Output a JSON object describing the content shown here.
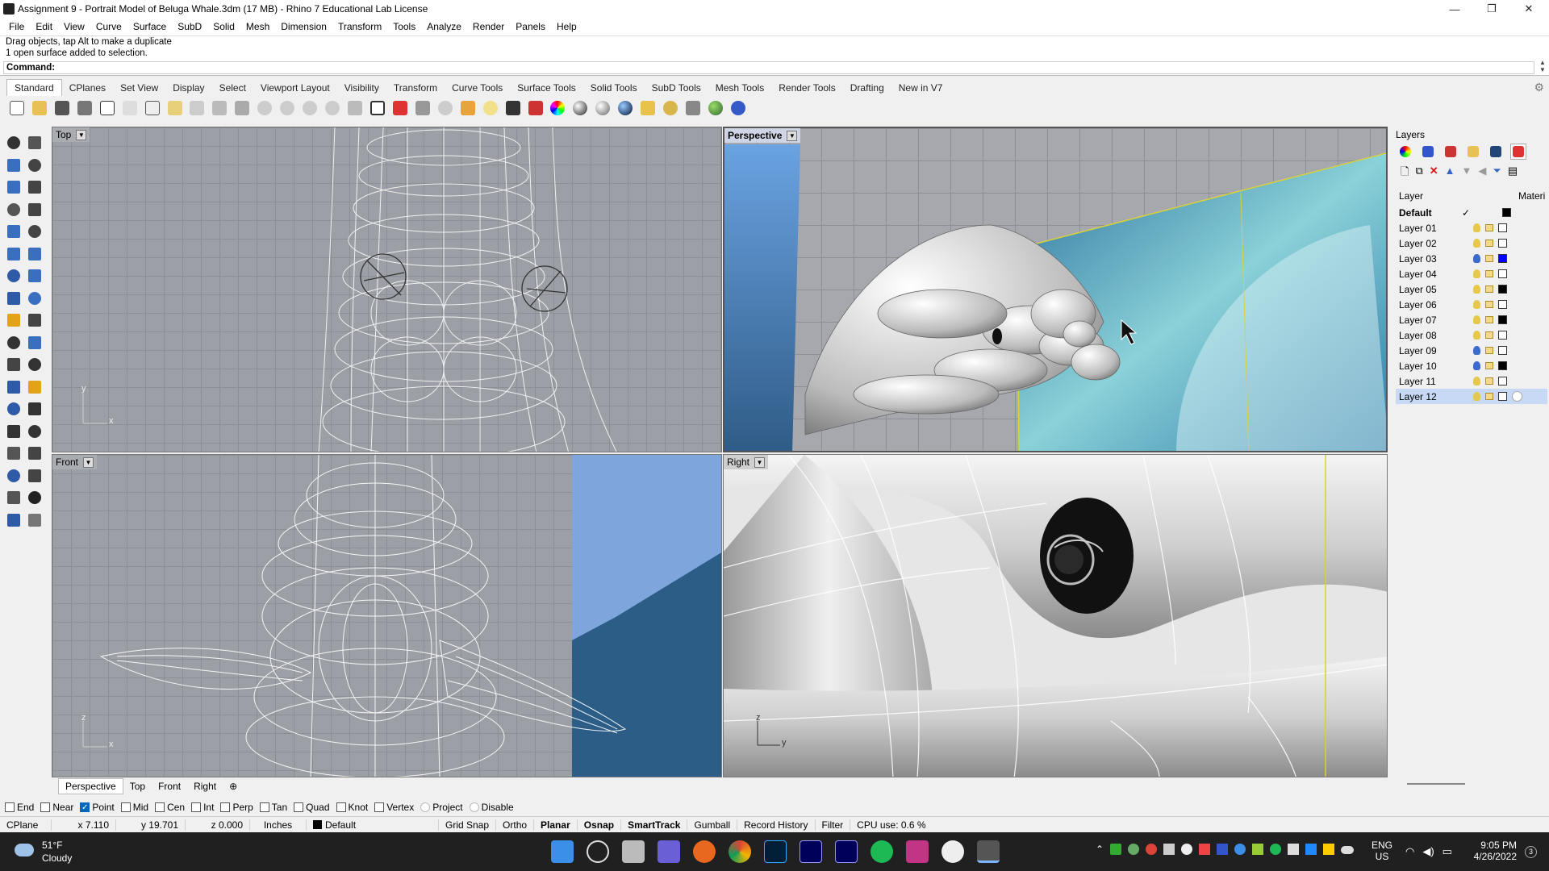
{
  "window": {
    "title": "Assignment 9 - Portrait Model of Beluga Whale.3dm (17 MB) - Rhino 7 Educational Lab License",
    "min": "—",
    "max": "❐",
    "close": "✕"
  },
  "menu": [
    "File",
    "Edit",
    "View",
    "Curve",
    "Surface",
    "SubD",
    "Solid",
    "Mesh",
    "Dimension",
    "Transform",
    "Tools",
    "Analyze",
    "Render",
    "Panels",
    "Help"
  ],
  "command": {
    "history1": "Drag objects, tap Alt to make a duplicate",
    "history2": "1 open surface added to selection.",
    "prompt": "Command:"
  },
  "toolbar_tabs": [
    "Standard",
    "CPlanes",
    "Set View",
    "Display",
    "Select",
    "Viewport Layout",
    "Visibility",
    "Transform",
    "Curve Tools",
    "Surface Tools",
    "Solid Tools",
    "SubD Tools",
    "Mesh Tools",
    "Render Tools",
    "Drafting",
    "New in V7"
  ],
  "viewports": {
    "top": "Top",
    "perspective": "Perspective",
    "front": "Front",
    "right": "Right"
  },
  "axes": {
    "top_y": "y",
    "top_x": "x",
    "front_z": "z",
    "front_x": "x",
    "right_z": "z",
    "right_y": "y"
  },
  "view_tabs": [
    "Perspective",
    "Top",
    "Front",
    "Right"
  ],
  "layers": {
    "title": "Layers",
    "col_layer": "Layer",
    "col_material": "Materi",
    "rows": [
      {
        "name": "Default",
        "color": "#000000"
      },
      {
        "name": "Layer 01",
        "color": "#ffffff"
      },
      {
        "name": "Layer 02",
        "color": "#ffffff"
      },
      {
        "name": "Layer 03",
        "color": "#0000ff"
      },
      {
        "name": "Layer 04",
        "color": "#ffffff"
      },
      {
        "name": "Layer 05",
        "color": "#000000"
      },
      {
        "name": "Layer 06",
        "color": "#ffffff"
      },
      {
        "name": "Layer 07",
        "color": "#000000"
      },
      {
        "name": "Layer 08",
        "color": "#ffffff"
      },
      {
        "name": "Layer 09",
        "color": "#ffffff"
      },
      {
        "name": "Layer 10",
        "color": "#000000"
      },
      {
        "name": "Layer 11",
        "color": "#ffffff"
      },
      {
        "name": "Layer 12",
        "color": "#ffffff"
      }
    ],
    "current_mark": "✓"
  },
  "osnaps": [
    {
      "label": "End",
      "on": false
    },
    {
      "label": "Near",
      "on": false
    },
    {
      "label": "Point",
      "on": true
    },
    {
      "label": "Mid",
      "on": false
    },
    {
      "label": "Cen",
      "on": false
    },
    {
      "label": "Int",
      "on": false
    },
    {
      "label": "Perp",
      "on": false
    },
    {
      "label": "Tan",
      "on": false
    },
    {
      "label": "Quad",
      "on": false
    },
    {
      "label": "Knot",
      "on": false
    },
    {
      "label": "Vertex",
      "on": false
    },
    {
      "label": "Project",
      "on": false
    },
    {
      "label": "Disable",
      "on": false
    }
  ],
  "status": {
    "cplane": "CPlane",
    "x": "x 7.110",
    "y": "y 19.701",
    "z": "z 0.000",
    "units": "Inches",
    "layer": "Default",
    "grid_snap": "Grid Snap",
    "ortho": "Ortho",
    "planar": "Planar",
    "osnap": "Osnap",
    "smarttrack": "SmartTrack",
    "gumball": "Gumball",
    "record_history": "Record History",
    "filter": "Filter",
    "cpu": "CPU use: 0.6 %"
  },
  "taskbar": {
    "temp": "51°F",
    "weather": "Cloudy",
    "lang1": "ENG",
    "lang2": "US",
    "time": "9:05 PM",
    "date": "4/26/2022"
  }
}
